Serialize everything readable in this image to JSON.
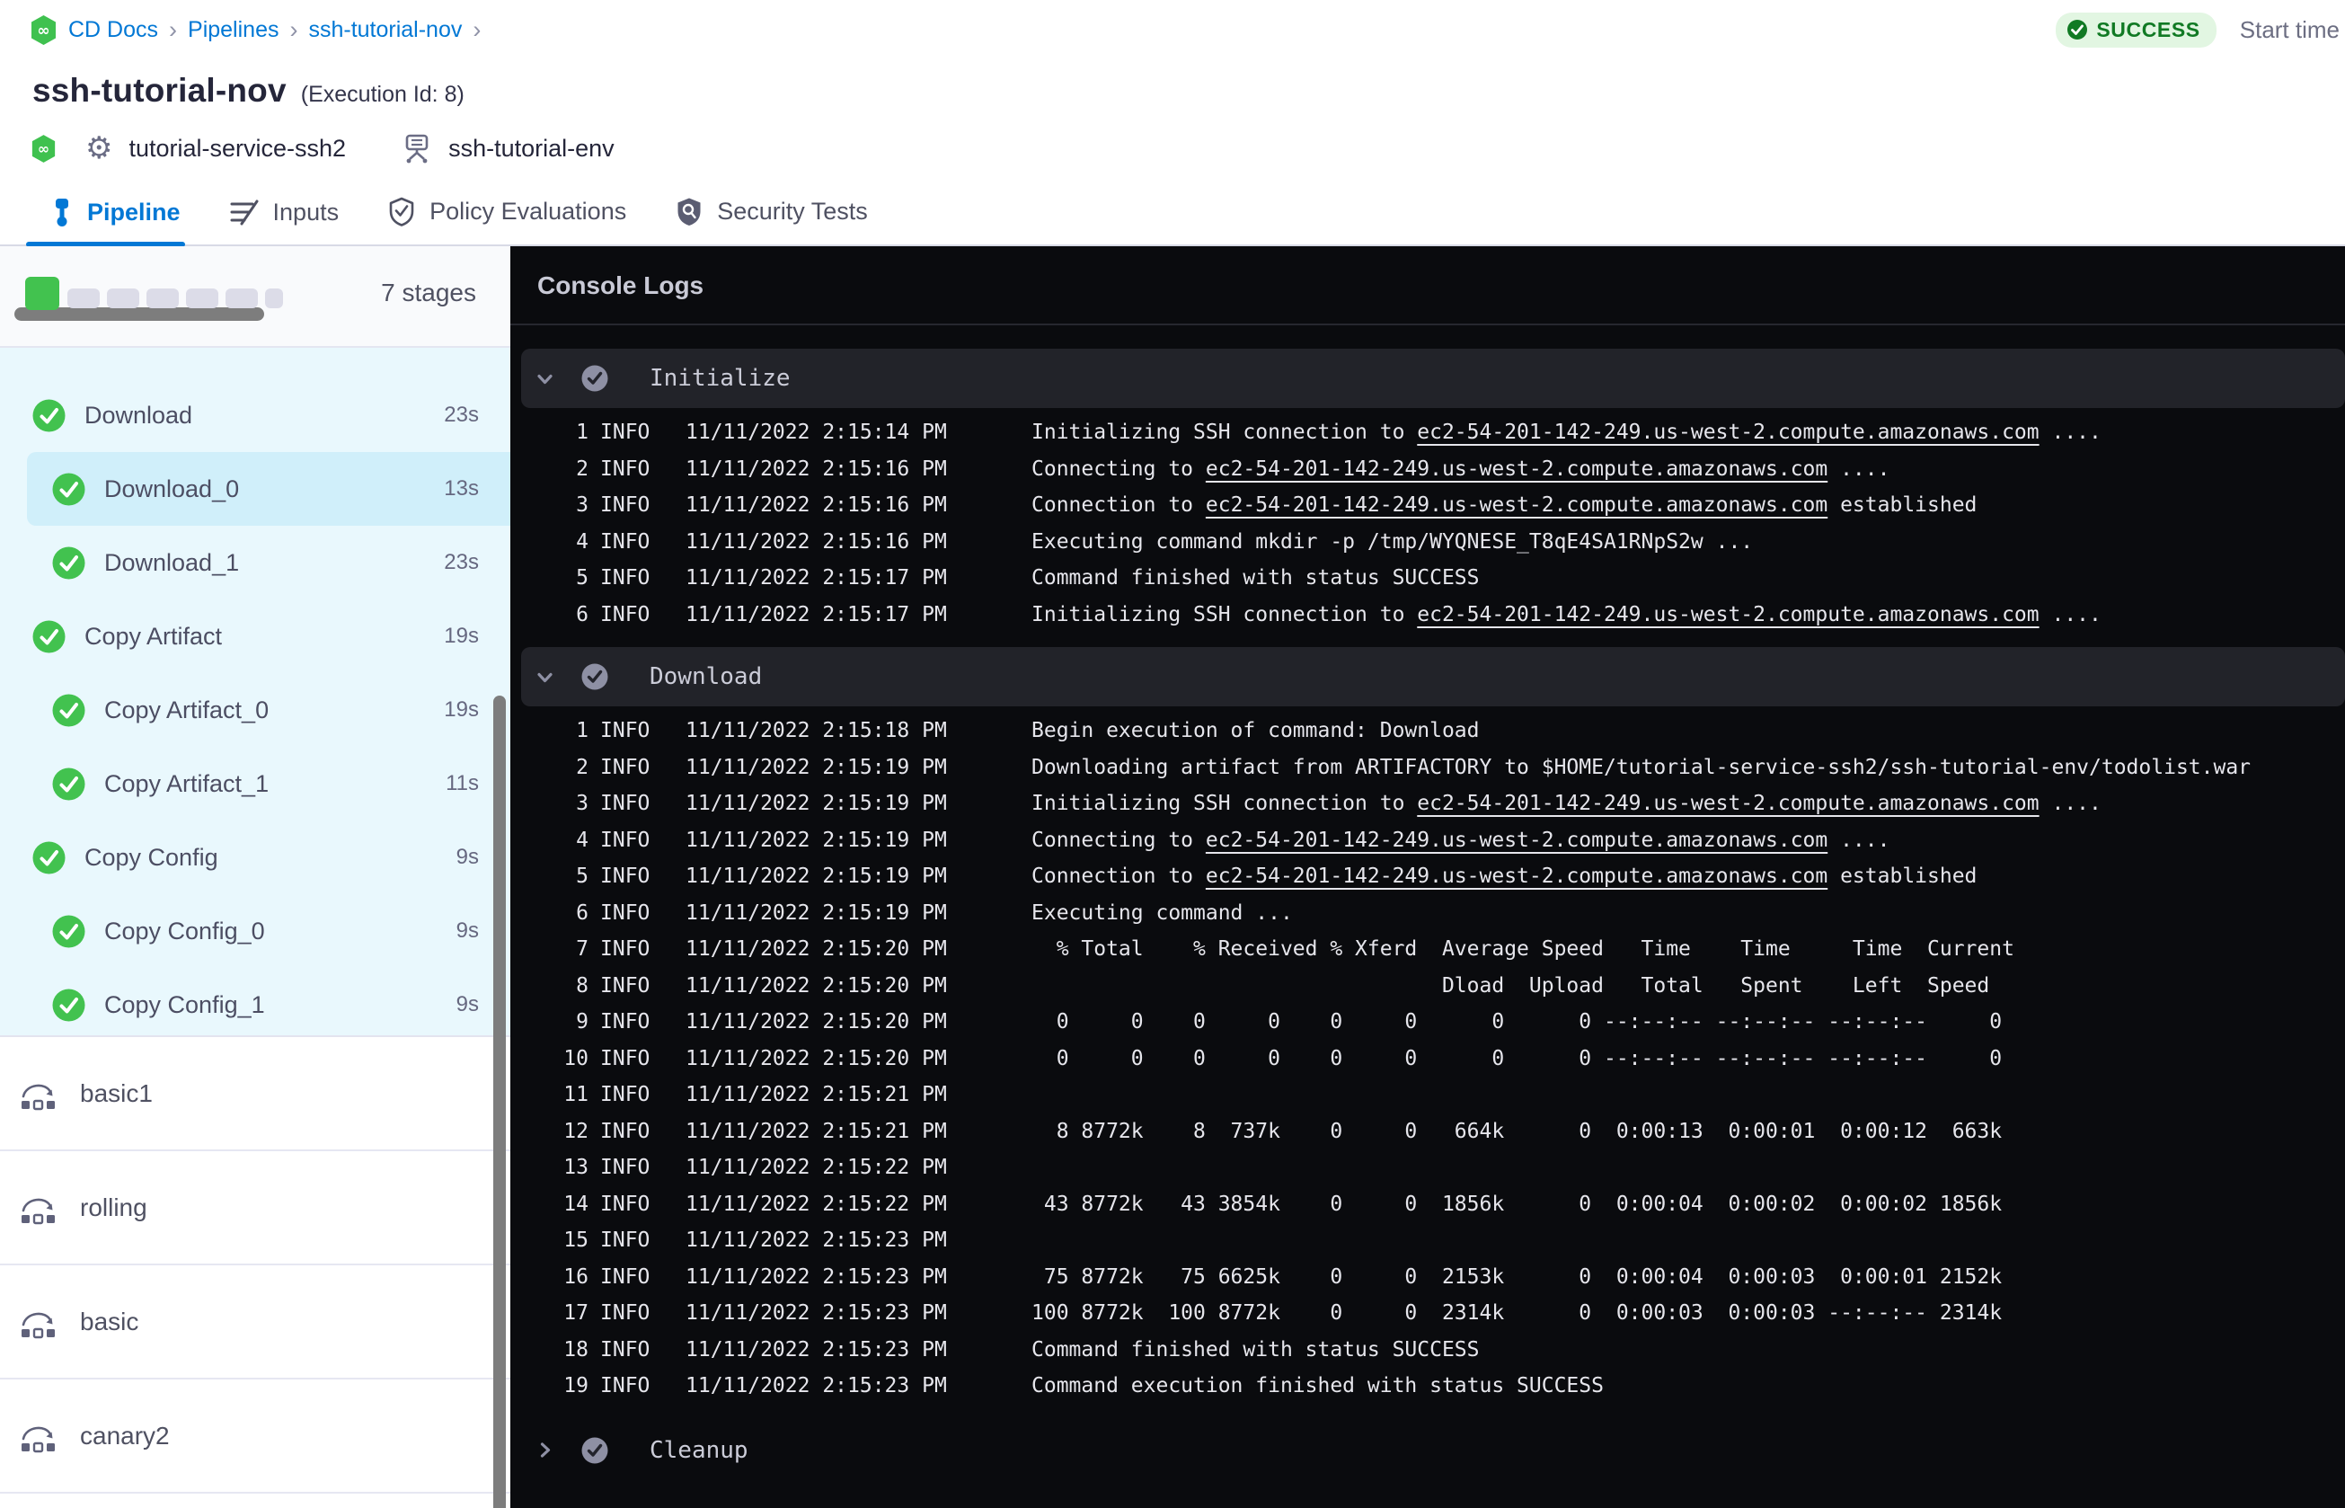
{
  "header": {
    "breadcrumb": [
      {
        "label": "CD Docs"
      },
      {
        "label": "Pipelines"
      },
      {
        "label": "ssh-tutorial-nov"
      }
    ],
    "title": "ssh-tutorial-nov",
    "execution_id_label": "(Execution Id: 8)",
    "service_name": "tutorial-service-ssh2",
    "environment_name": "ssh-tutorial-env",
    "status": "SUCCESS",
    "start_time_label": "Start time"
  },
  "tabs": [
    {
      "label": "Pipeline",
      "active": true
    },
    {
      "label": "Inputs",
      "active": false
    },
    {
      "label": "Policy Evaluations",
      "active": false
    },
    {
      "label": "Security Tests",
      "active": false
    }
  ],
  "stages": {
    "count_label": "7 stages",
    "progress": {
      "completed": 1,
      "total": 7
    },
    "items": [
      {
        "label": "Download",
        "duration": "23s",
        "indent": 0,
        "selected": false
      },
      {
        "label": "Download_0",
        "duration": "13s",
        "indent": 1,
        "selected": true
      },
      {
        "label": "Download_1",
        "duration": "23s",
        "indent": 1,
        "selected": false
      },
      {
        "label": "Copy Artifact",
        "duration": "19s",
        "indent": 0,
        "selected": false
      },
      {
        "label": "Copy Artifact_0",
        "duration": "19s",
        "indent": 1,
        "selected": false
      },
      {
        "label": "Copy Artifact_1",
        "duration": "11s",
        "indent": 1,
        "selected": false
      },
      {
        "label": "Copy Config",
        "duration": "9s",
        "indent": 0,
        "selected": false
      },
      {
        "label": "Copy Config_0",
        "duration": "9s",
        "indent": 1,
        "selected": false
      },
      {
        "label": "Copy Config_1",
        "duration": "9s",
        "indent": 1,
        "selected": false
      }
    ],
    "other_pipelines": [
      {
        "label": "basic1"
      },
      {
        "label": "rolling"
      },
      {
        "label": "basic"
      },
      {
        "label": "canary2"
      }
    ]
  },
  "console": {
    "title": "Console Logs",
    "host": "ec2-54-201-142-249.us-west-2.compute.amazonaws.com",
    "sections": [
      {
        "name": "Initialize",
        "collapsed": false,
        "lines": [
          {
            "n": 1,
            "level": "INFO",
            "ts": "11/11/2022 2:15:14 PM",
            "msg": [
              {
                "t": "Initializing SSH connection to "
              },
              {
                "t": "ec2-54-201-142-249.us-west-2.compute.amazonaws.com",
                "link": true
              },
              {
                "t": " ...."
              }
            ]
          },
          {
            "n": 2,
            "level": "INFO",
            "ts": "11/11/2022 2:15:16 PM",
            "msg": [
              {
                "t": "Connecting to "
              },
              {
                "t": "ec2-54-201-142-249.us-west-2.compute.amazonaws.com",
                "link": true
              },
              {
                "t": " ...."
              }
            ]
          },
          {
            "n": 3,
            "level": "INFO",
            "ts": "11/11/2022 2:15:16 PM",
            "msg": [
              {
                "t": "Connection to "
              },
              {
                "t": "ec2-54-201-142-249.us-west-2.compute.amazonaws.com",
                "link": true
              },
              {
                "t": " established"
              }
            ]
          },
          {
            "n": 4,
            "level": "INFO",
            "ts": "11/11/2022 2:15:16 PM",
            "msg": [
              {
                "t": "Executing command mkdir -p /tmp/WYQNESE_T8qE4SA1RNpS2w ..."
              }
            ]
          },
          {
            "n": 5,
            "level": "INFO",
            "ts": "11/11/2022 2:15:17 PM",
            "msg": [
              {
                "t": "Command finished with status SUCCESS"
              }
            ]
          },
          {
            "n": 6,
            "level": "INFO",
            "ts": "11/11/2022 2:15:17 PM",
            "msg": [
              {
                "t": "Initializing SSH connection to "
              },
              {
                "t": "ec2-54-201-142-249.us-west-2.compute.amazonaws.com",
                "link": true
              },
              {
                "t": " ...."
              }
            ]
          }
        ]
      },
      {
        "name": "Download",
        "collapsed": false,
        "lines": [
          {
            "n": 1,
            "level": "INFO",
            "ts": "11/11/2022 2:15:18 PM",
            "msg": [
              {
                "t": "Begin execution of command: Download"
              }
            ]
          },
          {
            "n": 2,
            "level": "INFO",
            "ts": "11/11/2022 2:15:19 PM",
            "msg": [
              {
                "t": "Downloading artifact from ARTIFACTORY to $HOME/tutorial-service-ssh2/ssh-tutorial-env/todolist.war"
              }
            ]
          },
          {
            "n": 3,
            "level": "INFO",
            "ts": "11/11/2022 2:15:19 PM",
            "msg": [
              {
                "t": "Initializing SSH connection to "
              },
              {
                "t": "ec2-54-201-142-249.us-west-2.compute.amazonaws.com",
                "link": true
              },
              {
                "t": " ...."
              }
            ]
          },
          {
            "n": 4,
            "level": "INFO",
            "ts": "11/11/2022 2:15:19 PM",
            "msg": [
              {
                "t": "Connecting to "
              },
              {
                "t": "ec2-54-201-142-249.us-west-2.compute.amazonaws.com",
                "link": true
              },
              {
                "t": " ...."
              }
            ]
          },
          {
            "n": 5,
            "level": "INFO",
            "ts": "11/11/2022 2:15:19 PM",
            "msg": [
              {
                "t": "Connection to "
              },
              {
                "t": "ec2-54-201-142-249.us-west-2.compute.amazonaws.com",
                "link": true
              },
              {
                "t": " established"
              }
            ]
          },
          {
            "n": 6,
            "level": "INFO",
            "ts": "11/11/2022 2:15:19 PM",
            "msg": [
              {
                "t": "Executing command ..."
              }
            ]
          },
          {
            "n": 7,
            "level": "INFO",
            "ts": "11/11/2022 2:15:20 PM",
            "msg": [
              {
                "t": "  % Total    % Received % Xferd  Average Speed   Time    Time     Time  Current"
              }
            ]
          },
          {
            "n": 8,
            "level": "INFO",
            "ts": "11/11/2022 2:15:20 PM",
            "msg": [
              {
                "t": "                                 Dload  Upload   Total   Spent    Left  Speed"
              }
            ]
          },
          {
            "n": 9,
            "level": "INFO",
            "ts": "11/11/2022 2:15:20 PM",
            "msg": [
              {
                "t": "  0     0    0     0    0     0      0      0 --:--:-- --:--:-- --:--:--     0"
              }
            ]
          },
          {
            "n": 10,
            "level": "INFO",
            "ts": "11/11/2022 2:15:20 PM",
            "msg": [
              {
                "t": "  0     0    0     0    0     0      0      0 --:--:-- --:--:-- --:--:--     0"
              }
            ]
          },
          {
            "n": 11,
            "level": "INFO",
            "ts": "11/11/2022 2:15:21 PM",
            "msg": []
          },
          {
            "n": 12,
            "level": "INFO",
            "ts": "11/11/2022 2:15:21 PM",
            "msg": [
              {
                "t": "  8 8772k    8  737k    0     0   664k      0  0:00:13  0:00:01  0:00:12  663k"
              }
            ]
          },
          {
            "n": 13,
            "level": "INFO",
            "ts": "11/11/2022 2:15:22 PM",
            "msg": []
          },
          {
            "n": 14,
            "level": "INFO",
            "ts": "11/11/2022 2:15:22 PM",
            "msg": [
              {
                "t": " 43 8772k   43 3854k    0     0  1856k      0  0:00:04  0:00:02  0:00:02 1856k"
              }
            ]
          },
          {
            "n": 15,
            "level": "INFO",
            "ts": "11/11/2022 2:15:23 PM",
            "msg": []
          },
          {
            "n": 16,
            "level": "INFO",
            "ts": "11/11/2022 2:15:23 PM",
            "msg": [
              {
                "t": " 75 8772k   75 6625k    0     0  2153k      0  0:00:04  0:00:03  0:00:01 2152k"
              }
            ]
          },
          {
            "n": 17,
            "level": "INFO",
            "ts": "11/11/2022 2:15:23 PM",
            "msg": [
              {
                "t": "100 8772k  100 8772k    0     0  2314k      0  0:00:03  0:00:03 --:--:-- 2314k"
              }
            ]
          },
          {
            "n": 18,
            "level": "INFO",
            "ts": "11/11/2022 2:15:23 PM",
            "msg": [
              {
                "t": "Command finished with status SUCCESS"
              }
            ]
          },
          {
            "n": 19,
            "level": "INFO",
            "ts": "11/11/2022 2:15:23 PM",
            "msg": [
              {
                "t": "Command execution finished with status SUCCESS"
              }
            ]
          }
        ]
      },
      {
        "name": "Cleanup",
        "collapsed": true,
        "lines": []
      }
    ]
  },
  "colors": {
    "accent_blue": "#0278d5",
    "success_green": "#42c24f",
    "badge_bg": "#e2f6e2",
    "badge_text": "#117a24",
    "sidebar_bg": "#e9f8fd",
    "selected_row_bg": "#d0effa",
    "console_bg": "#0a0b0e",
    "section_bar_bg": "#222329"
  }
}
